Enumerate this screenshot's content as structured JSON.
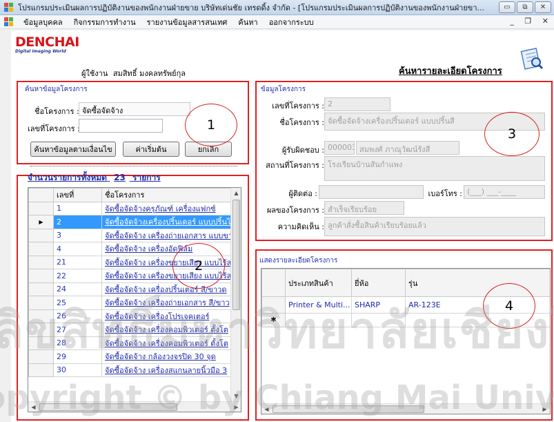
{
  "window": {
    "title": "โปรแกรมประเมินผลการปฏิบัติงานของพนักงานฝ่ายขาย บริษัทเด่นชัย เทรดดิ้ง จำกัด - [โปรแกรมประเมินผลการปฏิบัติงานของพนักงานฝ่ายขา...",
    "minimize": "▭",
    "restore": "⧉",
    "close": "✕",
    "mdi_controls": "_ ❐ ✕"
  },
  "menu": {
    "items": [
      "ข้อมูลบุคคล",
      "กิจกรรมการทำงาน",
      "รายงานข้อมูลสารสนเทศ",
      "ค้นหา",
      "ออกจากระบบ"
    ]
  },
  "header": {
    "logo_big": "DENCHAI",
    "logo_small": "Digital Imaging World",
    "user_label": "ผู้ใช้งาน",
    "user_name": "สมสิทธิ์ มงคลทรัพย์กุล",
    "page_title": "ค้นหารายละเอียดโครงการ"
  },
  "search_panel": {
    "title": "ค้นหาข้อมูลโครงการ",
    "name_label": "ชื่อโครงการ :",
    "name_value": "จัดซื้อจัดจ้าง",
    "id_label": "เลขที่โครงการ :",
    "id_value": "",
    "btn_search": "ค้นหาข้อมูลตามเงื่อนไข",
    "btn_reset": "ค่าเริ่มต้น",
    "btn_cancel": "ยกเลิก"
  },
  "list_panel": {
    "count_label": "จำนวนรายการทั้งหมด",
    "count_value": "23",
    "count_unit": "รายการ",
    "col_id": "เลขที่",
    "col_name": "ชื่อโครงการ",
    "rows": [
      {
        "id": "1",
        "name": "จัดซื้อจัดจ้างครุภัณฑ์ เครื่องแฟกซ์"
      },
      {
        "id": "2",
        "name": "จัดซื้อจัดจ้างเครื่องปริ้นเตอร์ แบบปริ้นไ"
      },
      {
        "id": "3",
        "name": "จัดซื้อจัดจ้าง เครื่องถ่ายเอกสาร แบบขา"
      },
      {
        "id": "4",
        "name": "จัดซื้อจัดจ้าง เครื่องอัดฟิล์ม"
      },
      {
        "id": "21",
        "name": "จัดซื้อจัดจ้าง เครื่องขยายเสียง แบบไร้ส"
      },
      {
        "id": "22",
        "name": "จัดซื้อจัดจ้าง เครื่องขยายเสียง แบบไร้ส"
      },
      {
        "id": "24",
        "name": "จัดซื้อจัดจ้าง เครื่องปริ้นเตอร์ สี/ขาวด"
      },
      {
        "id": "25",
        "name": "จัดซื้อจัดจ้าง เครื่องถ่ายเอกสาร สี/ขาว"
      },
      {
        "id": "26",
        "name": "จัดซื้อจัดจ้าง เครื่องโปรเจคเตอร์"
      },
      {
        "id": "27",
        "name": "จัดซื้อจัดจ้าง เครื่องคอมพิวเตอร์ ตั้งโต"
      },
      {
        "id": "28",
        "name": "จัดซื้อจัดจ้าง เครื่องคอมพิวเตอร์ ตั้งโต"
      },
      {
        "id": "29",
        "name": "จัดซื้อจัดจ้าง กล้องวงจรปิด 30 จุด"
      },
      {
        "id": "30",
        "name": "จัดซื้อจัดจ้าง เครื่องสแกนลายนิ้วมือ 3"
      }
    ],
    "selected_index": 1
  },
  "detail_panel": {
    "title": "ข้อมูลโครงการ",
    "id_label": "เลขที่โครงการ :",
    "id_value": "2",
    "name_label": "ชื่อโครงการ :",
    "name_value": "จัดซื้อจัดจ้างเครื่องปริ้นเตอร์ แบบปริ้นสี",
    "owner_label": "ผู้รับผิดชอบ :",
    "owner_id": "000003",
    "owner_name": "สมพงศ์ ภาณุวัฒน์รังสี",
    "place_label": "สถานที่โครงการ :",
    "place_value": "โรงเรียนบ้านสันกำแพง",
    "contact_label": "ผู้ติดต่อ :",
    "contact_value": "",
    "phone_label": "เบอร์โทร :",
    "phone_value": "(___) ___-____",
    "result_label": "ผลของโครงการ :",
    "result_value": "สำเร็จเรียบร้อย",
    "comment_label": "ความคิดเห็น :",
    "comment_value": "ลูกค้าสั่งซื้อสินค้าเรียบร้อยแล้ว"
  },
  "items_panel": {
    "title": "แสดงรายละเอียดโครงการ",
    "col_type": "ประเภทสินค้า",
    "col_brand": "ยี่ห้อ",
    "col_model": "รุ่น",
    "row": {
      "type": "Printer & Multi...",
      "brand": "SHARP",
      "model": "AR-123E"
    },
    "new_row_marker": "✱"
  },
  "annotations": {
    "c1": "1",
    "c2": "2",
    "c3": "3",
    "c4": "4"
  },
  "watermark": {
    "line1": "ลิขสิทธิ์มหาวิทยาลัยเชียงใหม่",
    "line2": "Copyright © by Chiang Mai University"
  },
  "colors": {
    "accent": "#e02020",
    "link": "#1d2aa8",
    "selection": "#3399ff"
  }
}
